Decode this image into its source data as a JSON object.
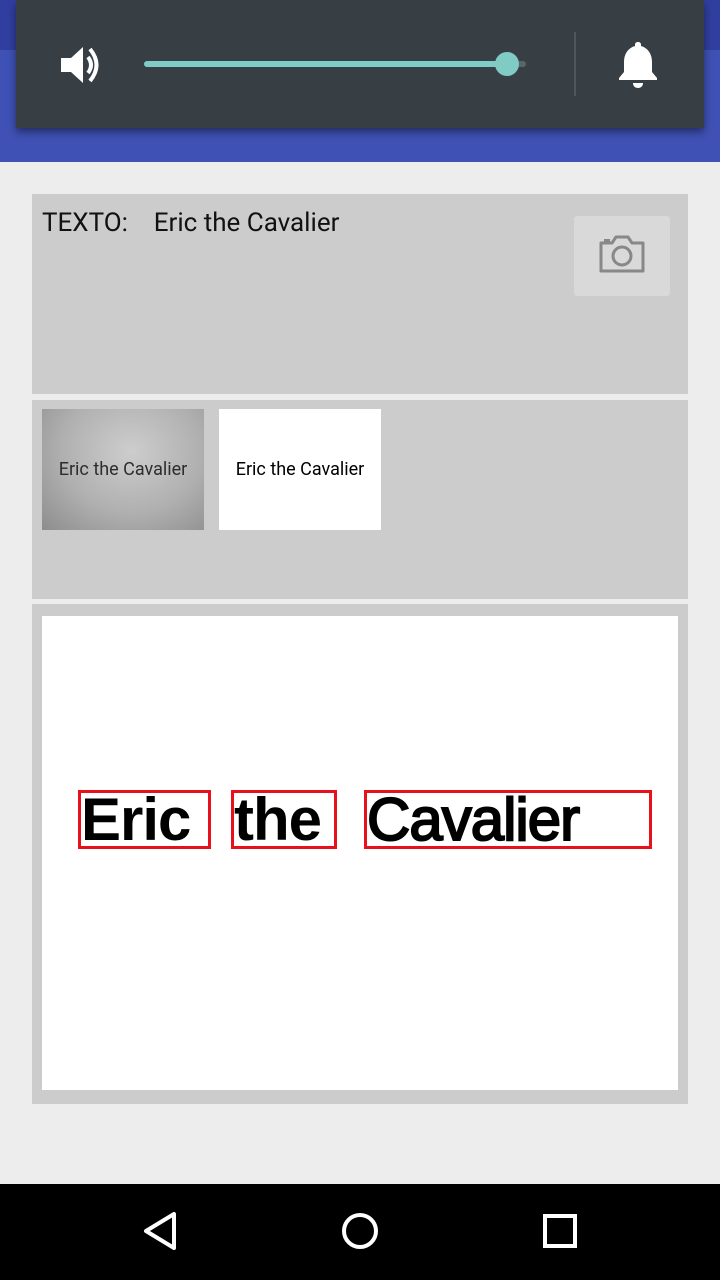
{
  "volume": {
    "level_fraction": 0.95,
    "accent_color": "#80cbc4",
    "left_icon": "speaker-icon",
    "right_icon": "bell-icon"
  },
  "text_card": {
    "label": "TEXTO:",
    "value": "Eric the Cavalier",
    "camera_icon": "camera-icon"
  },
  "thumbnails": [
    {
      "caption": "Eric the Cavalier"
    },
    {
      "caption": "Eric the Cavalier"
    }
  ],
  "result": {
    "words": [
      "Eric",
      "the",
      "Cavalier"
    ],
    "box_color": "#e8101a"
  },
  "nav": {
    "back_icon": "back-triangle-icon",
    "home_icon": "home-circle-icon",
    "recents_icon": "recents-square-icon"
  }
}
